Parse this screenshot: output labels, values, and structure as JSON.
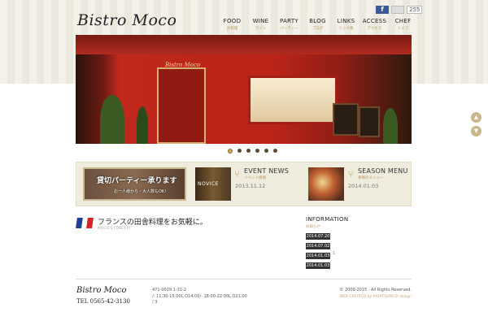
{
  "header": {
    "logo": "Bistro  Moco",
    "social": {
      "fb_label": "f",
      "like_count": "255"
    },
    "nav": [
      {
        "en": "FOOD",
        "ja": "お料理"
      },
      {
        "en": "WINE",
        "ja": "ワイン"
      },
      {
        "en": "PARTY",
        "ja": "パーティー"
      },
      {
        "en": "BLOG",
        "ja": "ブログ"
      },
      {
        "en": "LINKS",
        "ja": "リンク集"
      },
      {
        "en": "ACCESS",
        "ja": "アクセス"
      },
      {
        "en": "CHEF",
        "ja": "シェフ"
      }
    ]
  },
  "hero": {
    "shop_sign": "Bistro  Moco",
    "slide_count": 6,
    "active_slide": 0
  },
  "side": {
    "up_icon": "chevron-up-icon",
    "down_icon": "chevron-down-icon"
  },
  "banners": {
    "party": {
      "title": "貸切パーティー承ります",
      "sub": "お一人様から・大人数もOK！"
    },
    "novice": {
      "label": "NOVICE"
    },
    "event": {
      "title": "EVENT NEWS",
      "sub": "イベント情報",
      "date": "2013.11.12"
    },
    "season": {
      "title": "SEASON MENU",
      "sub": "季節のメニュー",
      "date": "2014.01.03"
    }
  },
  "concept": {
    "title": "フランスの田舎料理をお気軽に。",
    "sub": "MOCO'S CONCEPT"
  },
  "information": {
    "title": "INFORMATION",
    "sub": "お知らせ",
    "items": [
      "2014.07.20",
      "2014.07.02",
      "2014.01.03",
      "2014.01.03"
    ],
    "mark": "1"
  },
  "footer": {
    "logo": "Bistro  Moco",
    "tel": "TEL  0565-42-3130",
    "address_line1": "471-0029 1-31-2",
    "address_line2": "/- 11:30-15:00L.O14:00/- 18:00-22:00L.O21:00",
    "address_line3": "/ 3",
    "copyright": "© 2009-2015 . All Rights Reserved.",
    "credit": "WEB CREATED by KAYATSUMUSI design"
  },
  "colors": {
    "accent": "#b89a5e",
    "dark": "#333333",
    "brand_red": "#b12a1e"
  }
}
